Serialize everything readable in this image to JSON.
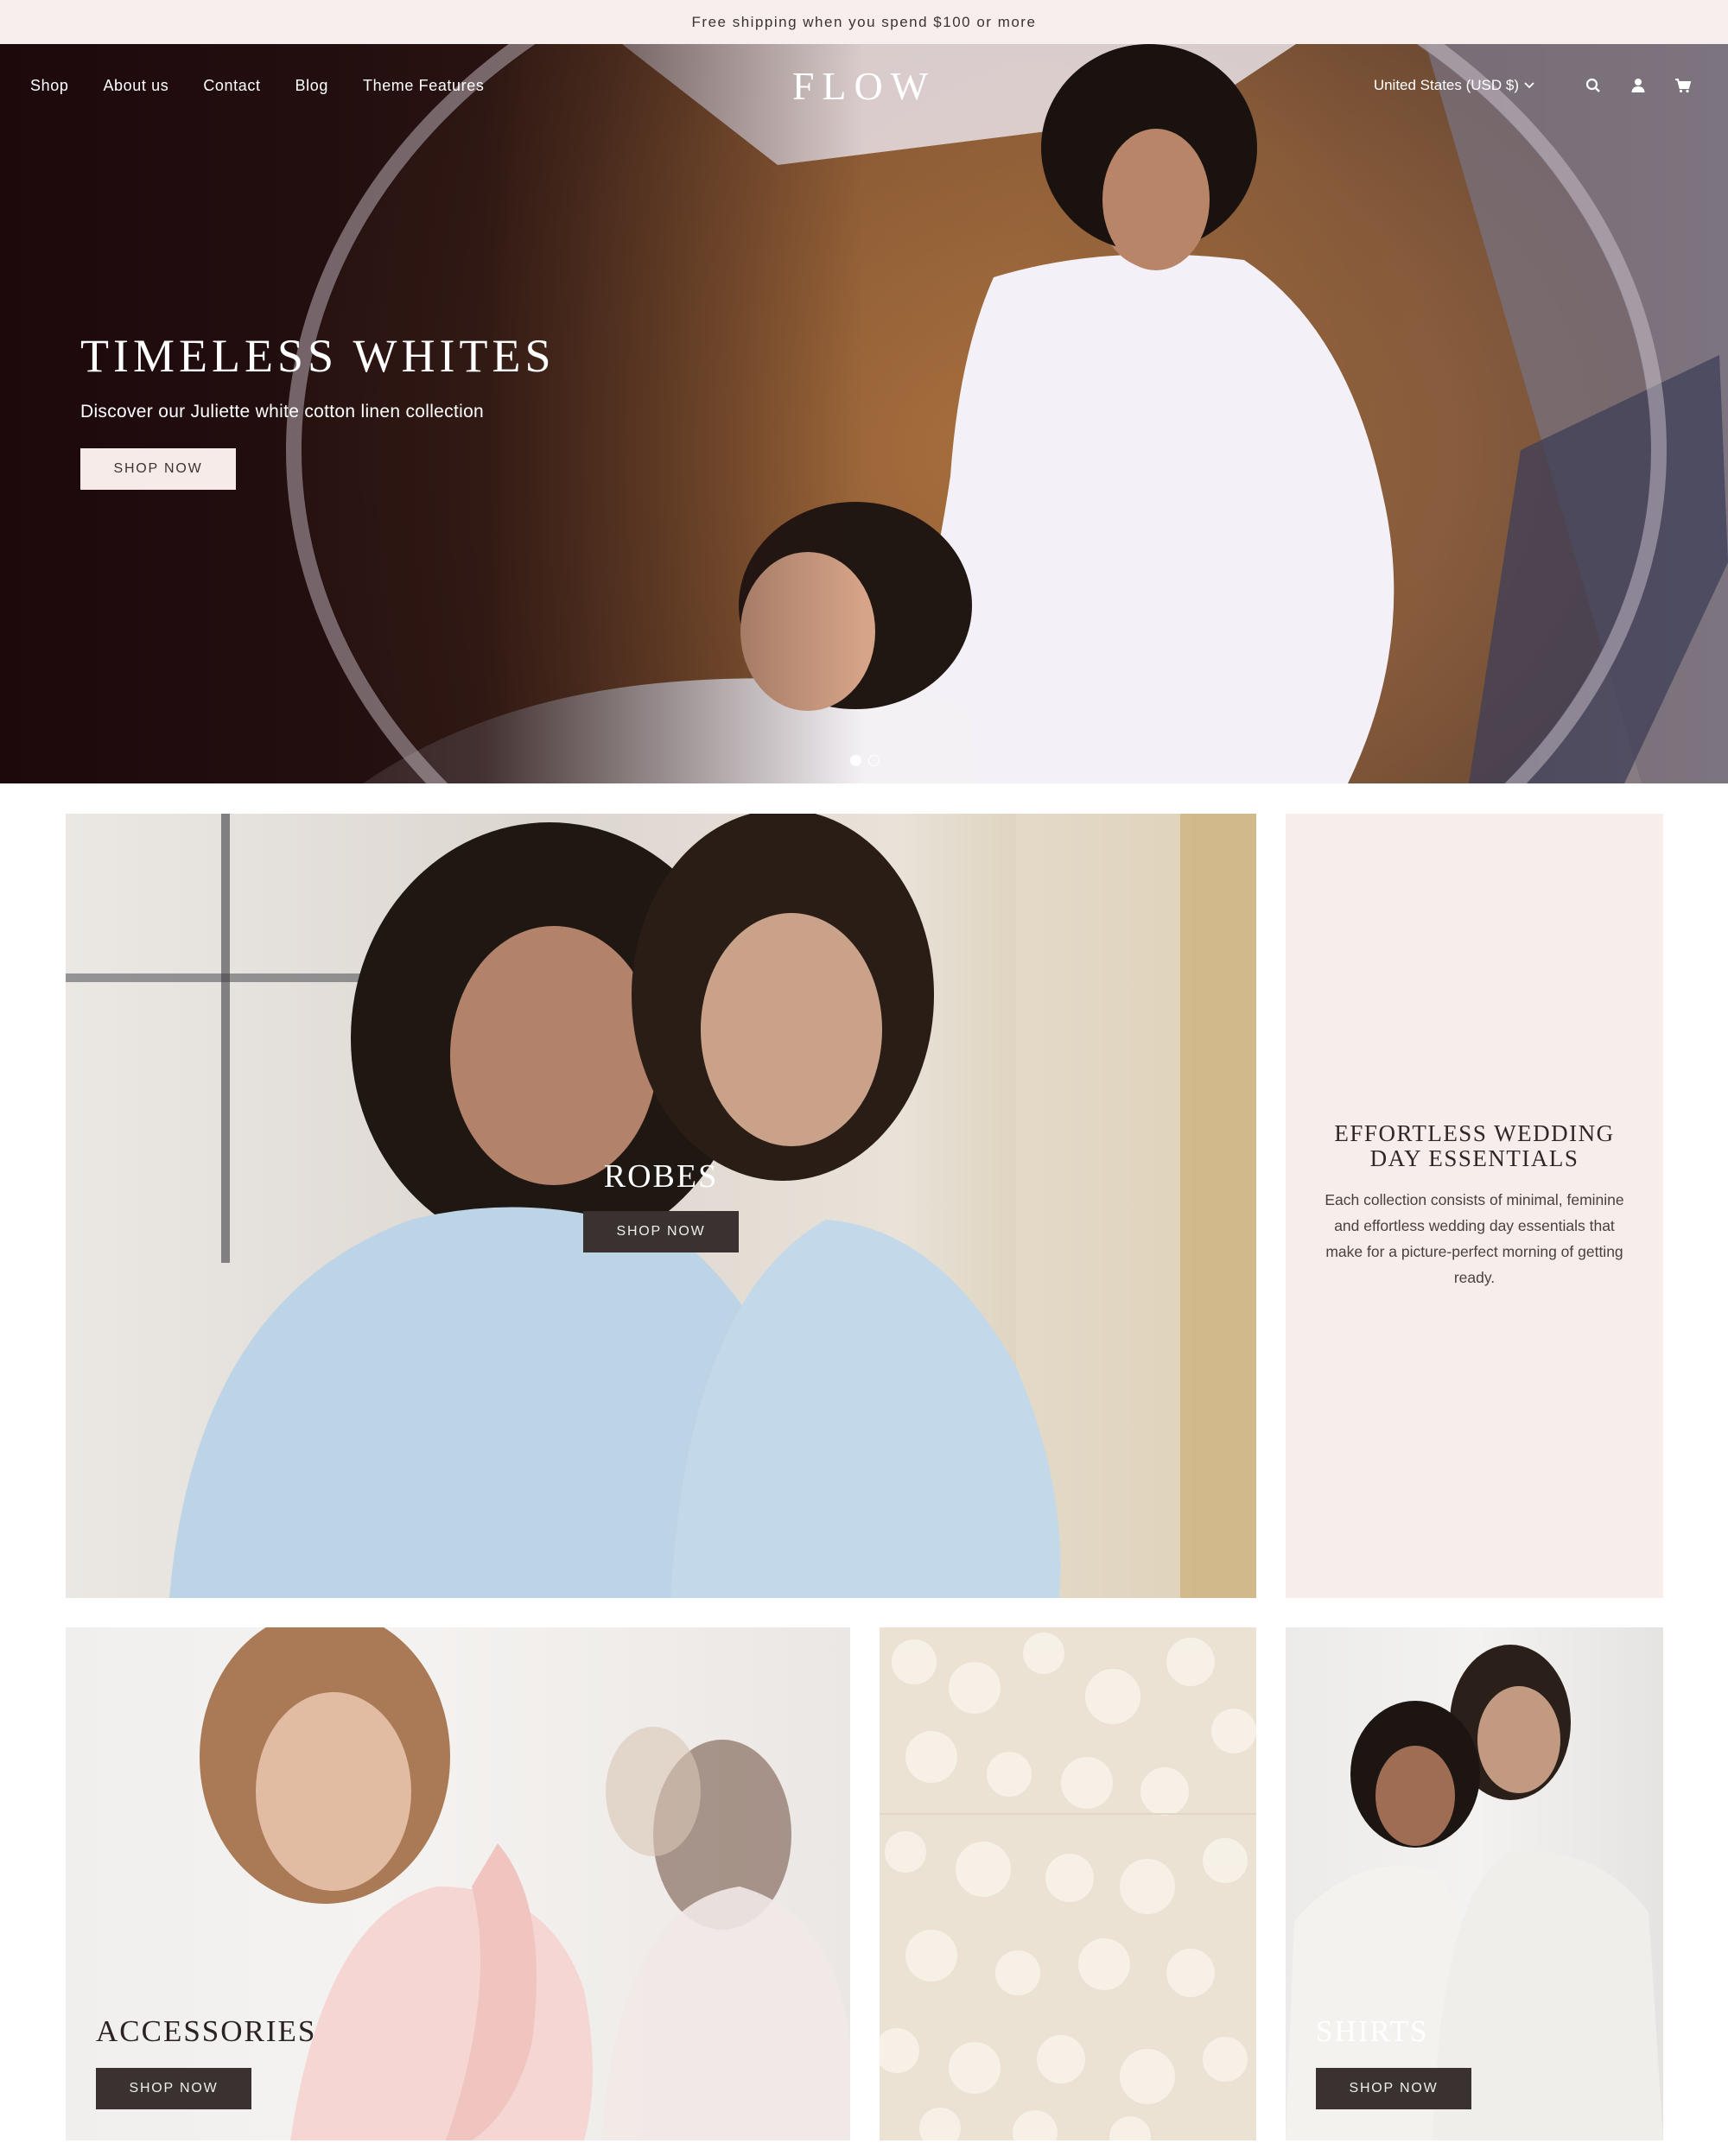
{
  "announcement": {
    "text": "Free shipping when you spend $100 or more"
  },
  "header": {
    "logo": "FLOW",
    "nav": [
      "Shop",
      "About us",
      "Contact",
      "Blog",
      "Theme Features"
    ],
    "currency": "United States (USD $)",
    "icons": [
      "search-icon",
      "account-icon",
      "cart-icon"
    ]
  },
  "hero": {
    "title": "TIMELESS WHITES",
    "subtitle": "Discover our Juliette white cotton linen collection",
    "button": "SHOP NOW",
    "slides": 2,
    "active_slide": 1
  },
  "collections": {
    "robes": {
      "title": "ROBES",
      "button": "SHOP NOW"
    },
    "essentials": {
      "title": "EFFORTLESS WEDDING DAY ESSENTIALS",
      "body": "Each collection consists of minimal, feminine and effortless wedding day essentials that make for a picture-perfect morning of getting ready."
    },
    "accessories": {
      "title": "ACCESSORIES",
      "button": "SHOP NOW"
    },
    "shirts": {
      "title": "SHIRTS",
      "button": "SHOP NOW"
    }
  },
  "colors": {
    "announcement_bg": "#f7efed",
    "essentials_bg": "#f7eeeb",
    "dark_button": "#3a3231",
    "light_button": "#f7ebe9"
  }
}
